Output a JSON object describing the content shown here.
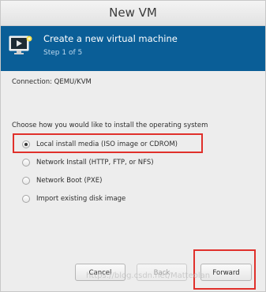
{
  "window": {
    "title": "New VM"
  },
  "header": {
    "title": "Create a new virtual machine",
    "step": "Step 1 of 5",
    "icon": "monitor-icon",
    "background": "#0a5e97"
  },
  "connection": "Connection:  QEMU/KVM",
  "question": "Choose how you would like to install the operating system",
  "install_options": [
    {
      "label": "Local install media (ISO image or CDROM)",
      "selected": true
    },
    {
      "label": "Network Install (HTTP, FTP, or NFS)",
      "selected": false
    },
    {
      "label": "Network Boot (PXE)",
      "selected": false
    },
    {
      "label": "Import existing disk image",
      "selected": false
    }
  ],
  "buttons": {
    "cancel": "Cancel",
    "back": "Back",
    "forward": "Forward"
  },
  "watermark": "https://blog.csdn.net/Matteolan",
  "highlight_color": "#e0302b"
}
